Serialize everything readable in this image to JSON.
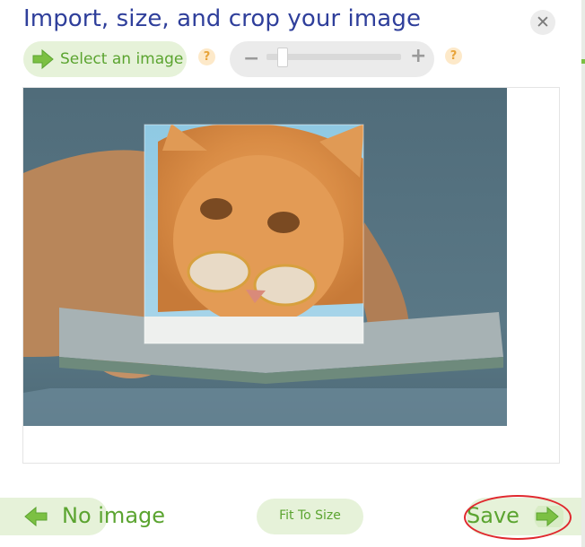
{
  "dialog": {
    "title": "Import, size, and crop your image",
    "close_symbol": "✕"
  },
  "toolbar": {
    "select_label": "Select an image",
    "help_symbol": "?",
    "zoom": {
      "minus_symbol": "−",
      "plus_symbol": "+",
      "level": 0.08
    }
  },
  "footer": {
    "back_label": "No image",
    "fit_label": "Fit To Size",
    "save_label": "Save"
  },
  "icons": {
    "arrow": "arrow-right-icon",
    "back": "arrow-left-icon",
    "close": "close-icon",
    "help": "help-icon"
  },
  "colors": {
    "title": "#2f3f9b",
    "accent_green": "#5ba430",
    "button_bg": "#e6f2d9",
    "help_orange": "#e8a43a",
    "annotation_red": "#e0282e"
  }
}
